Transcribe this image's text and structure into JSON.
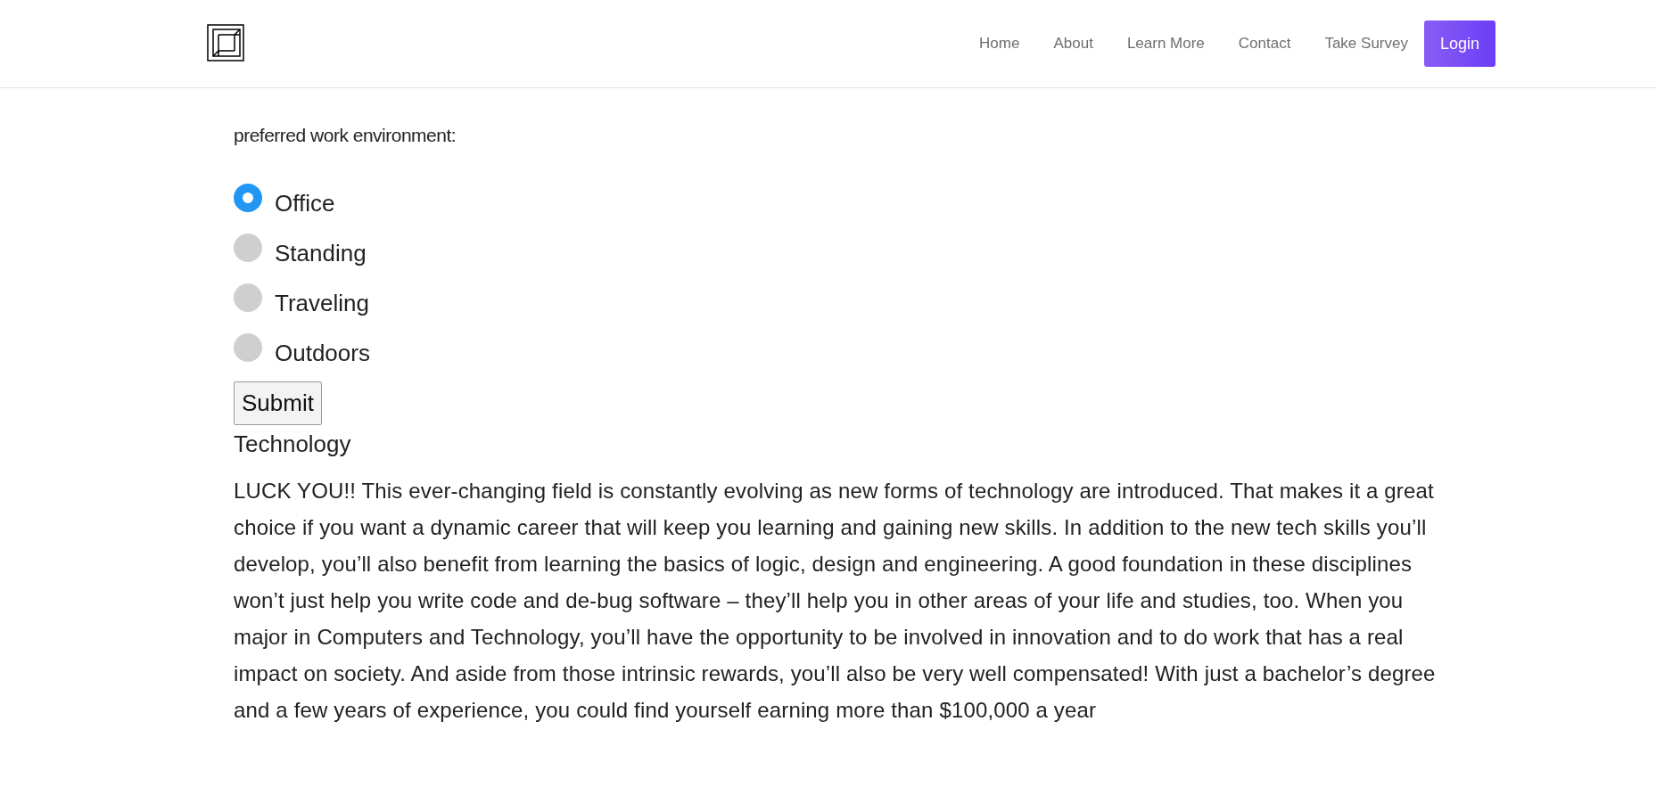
{
  "nav": {
    "links": [
      "Home",
      "About",
      "Learn More",
      "Contact",
      "Take Survey"
    ],
    "login": "Login"
  },
  "question": "preferred work environment:",
  "options": [
    {
      "label": "Office",
      "selected": true
    },
    {
      "label": "Standing",
      "selected": false
    },
    {
      "label": "Traveling",
      "selected": false
    },
    {
      "label": "Outdoors",
      "selected": false
    }
  ],
  "submit": "Submit",
  "result": {
    "title": "Technology",
    "text": "LUCK YOU!! This ever-changing field is constantly evolving as new forms of technology are introduced. That makes it a great choice if you want a dynamic career that will keep you learning and gaining new skills. In addition to the new tech skills you’ll develop, you’ll also benefit from learning the basics of logic, design and engineering. A good foundation in these disciplines won’t just help you write code and de-bug software – they’ll help you in other areas of your life and studies, too. When you major in Computers and Technology, you’ll have the opportunity to be involved in innovation and to do work that has a real impact on society. And aside from those intrinsic rewards, you’ll also be very well compensated! With just a bachelor’s degree and a few years of experience, you could find yourself earning more than $100,000 a year"
  }
}
